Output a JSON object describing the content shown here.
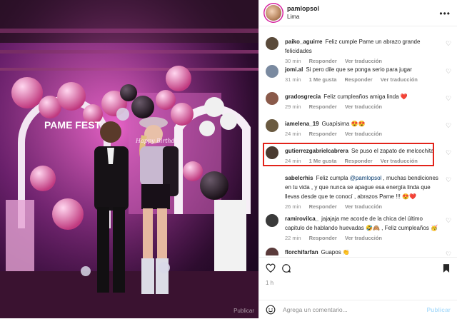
{
  "post": {
    "username": "pamlopsol",
    "location": "Lima",
    "more_icon": "more-options-icon",
    "photo_sign_text": "PAME FEST",
    "photo_banner_text": "Happy Birthday",
    "watermark": "Publicar"
  },
  "comments": [
    {
      "user": "paiko_aguirre",
      "text": "Feliz cumple Pame un abrazo grande felicidades",
      "time": "30 min",
      "reply": "Responder",
      "translate": "Ver traducción",
      "likes": "",
      "avatar_color": "#5a4a3a"
    },
    {
      "user": "jomi.al",
      "text": "Si pero dile que se ponga serio para jugar",
      "time": "31 min",
      "likes": "1 Me gusta",
      "reply": "Responder",
      "translate": "Ver traducción",
      "avatar_color": "#7a8aa0"
    },
    {
      "user": "gradosgrecia",
      "text": "Feliz cumpleaños amiga linda ❤️",
      "time": "29 min",
      "reply": "Responder",
      "translate": "Ver traducción",
      "likes": "",
      "avatar_color": "#8a5a4a"
    },
    {
      "user": "iamelena_19",
      "text": "Guapísima 😍😍",
      "time": "24 min",
      "reply": "Responder",
      "translate": "Ver traducción",
      "likes": "",
      "avatar_color": "#6a5a40"
    },
    {
      "user": "gutierrezgabrielcabrera",
      "text": "Se puso el zapato de melcochita",
      "time": "24 min",
      "likes": "1 Me gusta",
      "reply": "Responder",
      "translate": "Ver traducción",
      "avatar_color": "#4a3a30"
    },
    {
      "user": "sabelcrhis",
      "text": "Feliz cumpla @pamlopsol , muchas bendiciones en tu vida , y que nunca se apague esa energía linda que llevas desde que te conocí , abrazos Pame !!! 😍❤️",
      "mention": "@pamlopsol",
      "time": "26 min",
      "reply": "Responder",
      "translate": "Ver traducción",
      "likes": "",
      "avatar_color": "#ffffff"
    },
    {
      "user": "ramirovilca_",
      "text": "jajajaja me acorde de la chica del último capitulo de hablando huevadas 🤣🙈 , Feliz cumpleaños 🥳",
      "time": "22 min",
      "reply": "Responder",
      "translate": "Ver traducción",
      "likes": "",
      "avatar_color": "#3a3a3a"
    },
    {
      "user": "florchifarfan",
      "text": "Guapos 👏",
      "time": "",
      "reply": "",
      "translate": "",
      "likes": "",
      "avatar_color": "#5a3a3a"
    }
  ],
  "actions": {
    "like_icon": "heart-icon",
    "comment_icon": "comment-icon",
    "save_icon": "bookmark-icon"
  },
  "post_date": "1 h",
  "add_comment": {
    "placeholder": "Agrega un comentario...",
    "emoji_icon": "emoji-icon",
    "post_label": "Publicar"
  },
  "colors": {
    "highlight": "#e2231a",
    "mention": "#00376b",
    "secondary_text": "#8e8e8e"
  }
}
